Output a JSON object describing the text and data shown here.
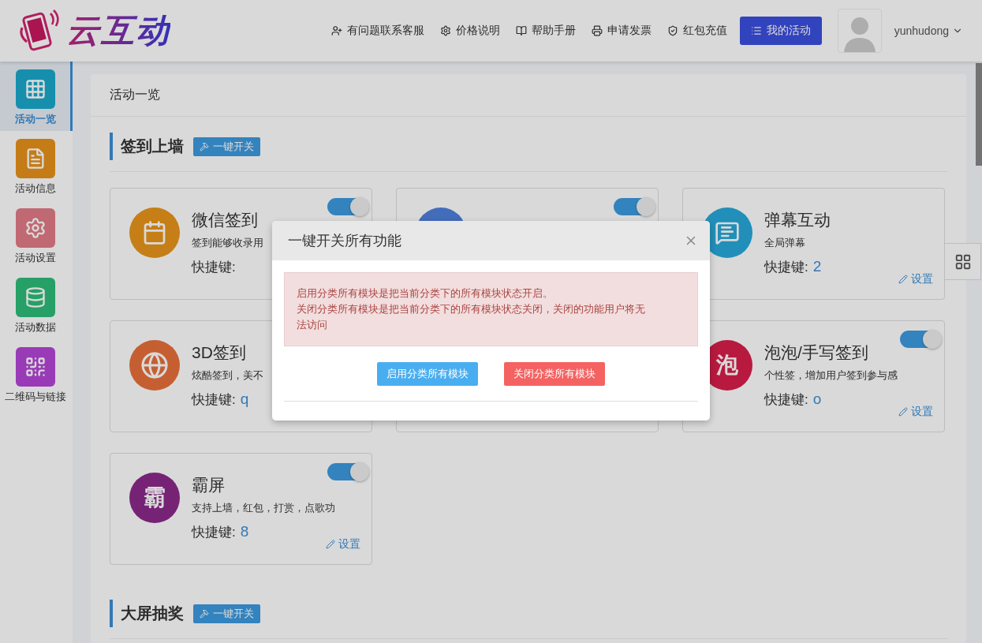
{
  "header": {
    "logo_text": "云互动",
    "links": [
      {
        "kind": "user-plus",
        "label": "有问题联系客服"
      },
      {
        "kind": "cog",
        "label": "价格说明"
      },
      {
        "kind": "book",
        "label": "帮助手册"
      },
      {
        "kind": "printer",
        "label": "申请发票"
      },
      {
        "kind": "shield",
        "label": "红包充值"
      }
    ],
    "primary_button": "我的活动",
    "username": "yunhudong"
  },
  "sidebar": {
    "items": [
      {
        "label": "活动一览",
        "kind": "grid",
        "selected": true
      },
      {
        "label": "活动信息",
        "kind": "file",
        "selected": false
      },
      {
        "label": "活动设置",
        "kind": "cog",
        "selected": false
      },
      {
        "label": "活动数据",
        "kind": "database",
        "selected": false
      },
      {
        "label": "二维码与链接",
        "kind": "qr",
        "selected": false
      }
    ]
  },
  "panel": {
    "title": "活动一览",
    "sections": [
      {
        "title": "签到上墙",
        "toggle_button": "一键开关",
        "cards": [
          {
            "kind": "calendar",
            "title": "微信签到",
            "description": "签到能够收录用",
            "shortcut_label": "快捷键:",
            "toggle_on": true
          },
          {
            "kind": "covered",
            "toggle_on": true
          },
          {
            "kind": "message",
            "title": "弹幕互动",
            "description": "全局弹幕",
            "shortcut_label": "快捷键:",
            "shortcut": "2",
            "settings": "设置"
          },
          {
            "kind": "globe",
            "title": "3D签到",
            "description": "炫酷签到，美不",
            "shortcut_label": "快捷键:",
            "shortcut": "q"
          },
          {
            "kind": "hidden"
          },
          {
            "kind": "glyph",
            "glyph": "泡",
            "title": "泡泡/手写签到",
            "description": "个性签，增加用户签到参与感",
            "shortcut_label": "快捷键:",
            "shortcut": "o",
            "settings": "设置",
            "toggle_on": true
          },
          {
            "kind": "glyph-purple",
            "glyph": "霸",
            "title": "霸屏",
            "description": "支持上墙，红包，打赏，点歌功",
            "shortcut_label": "快捷键:",
            "shortcut": "8",
            "settings": "设置",
            "toggle_on": true
          }
        ]
      },
      {
        "title": "大屏抽奖",
        "toggle_button": "一键开关"
      }
    ]
  },
  "modal": {
    "title": "一键开关所有功能",
    "alert_lines": [
      "启用分类所有模块是把当前分类下的所有模块状态开启。",
      "关闭分类所有模块是把当前分类下的所有模块状态关闭，关闭的功能用户将无法访问"
    ],
    "buttons": [
      {
        "kind": "enable",
        "label": "启用分类所有模块"
      },
      {
        "kind": "disable",
        "label": "关闭分类所有模块"
      }
    ]
  }
}
